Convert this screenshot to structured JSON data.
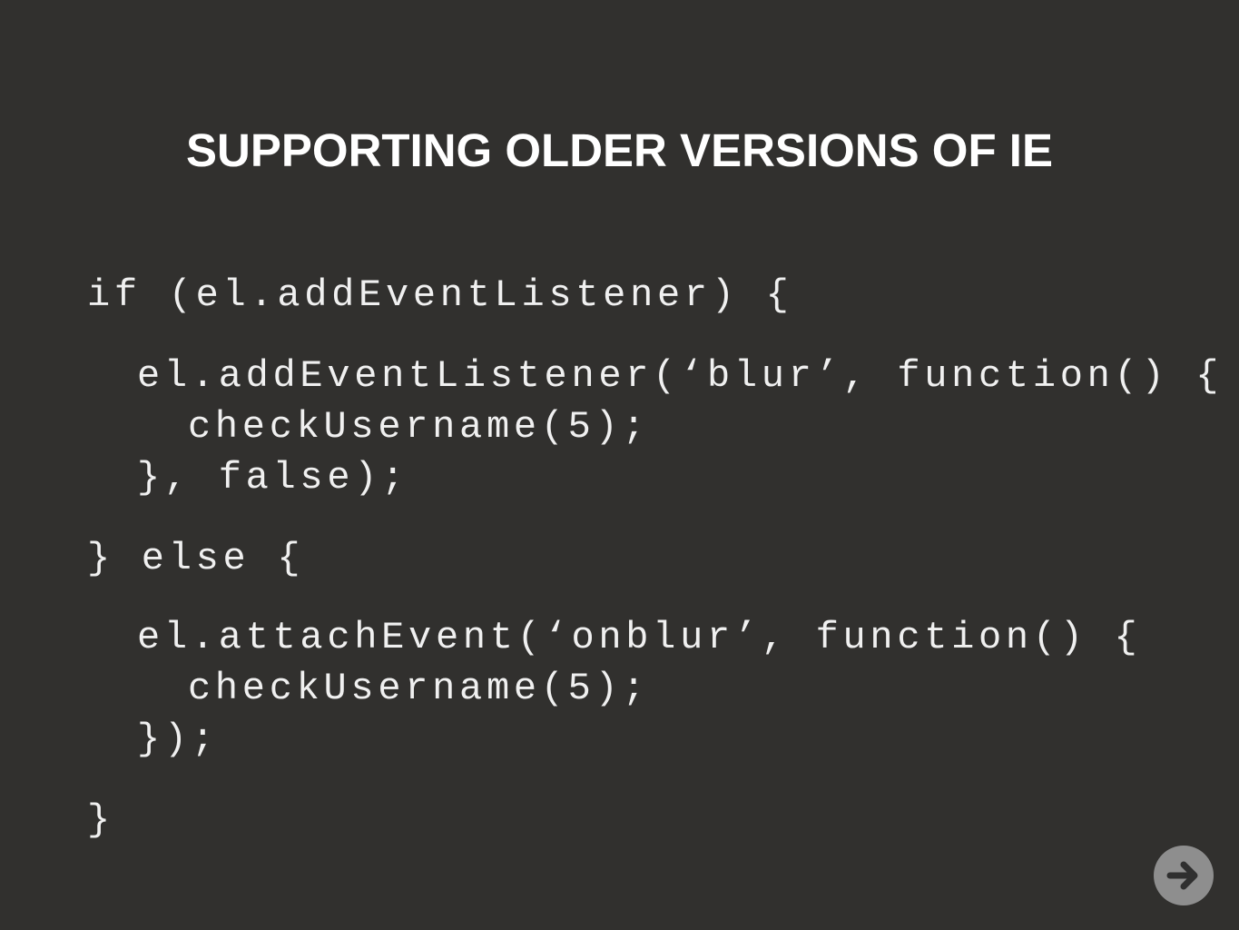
{
  "slide": {
    "title": "SUPPORTING OLDER VERSIONS OF IE",
    "code_lines": [
      "if (el.addEventListener) {",
      "el.addEventListener(‘blur’, function() {",
      "checkUsername(5);",
      "}, false);",
      "} else {",
      "el.attachEvent(‘onblur’, function() {",
      "checkUsername(5);",
      "});",
      "}"
    ]
  },
  "navigation": {
    "next_icon": "arrow-right-icon"
  },
  "colors": {
    "background": "#31302e",
    "title": "#ffffff",
    "code": "#f0f0f0",
    "next_button": "#8e8e8e",
    "next_arrow": "#2f2f2f"
  }
}
